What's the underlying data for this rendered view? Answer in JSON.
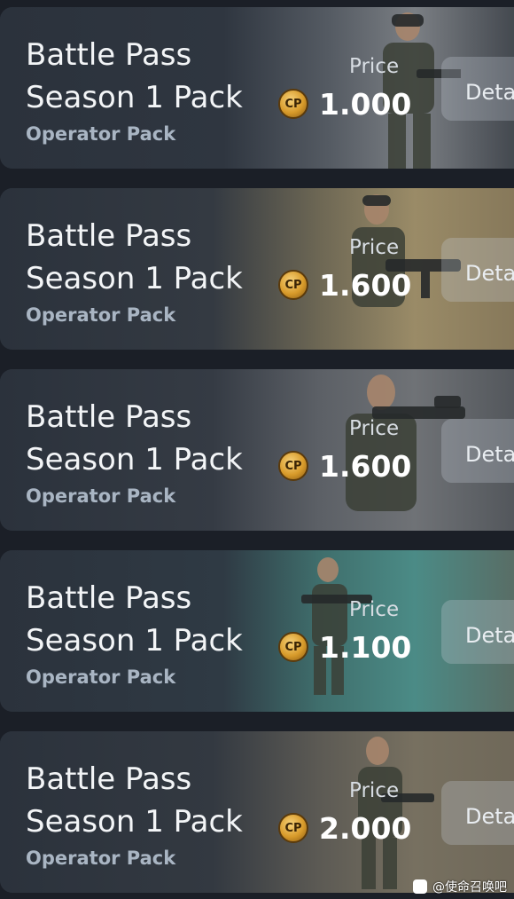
{
  "items": [
    {
      "title_line1": "Battle Pass",
      "title_line2": "Season 1 Pack",
      "subtitle": "Operator Pack",
      "price_label": "Price",
      "currency_icon": "CP",
      "price": "1.000",
      "details_label": "Deta"
    },
    {
      "title_line1": "Battle Pass",
      "title_line2": "Season 1 Pack",
      "subtitle": "Operator Pack",
      "price_label": "Price",
      "currency_icon": "CP",
      "price": "1.600",
      "details_label": "Deta"
    },
    {
      "title_line1": "Battle Pass",
      "title_line2": "Season 1 Pack",
      "subtitle": "Operator Pack",
      "price_label": "Price",
      "currency_icon": "CP",
      "price": "1.600",
      "details_label": "Deta"
    },
    {
      "title_line1": "Battle Pass",
      "title_line2": "Season 1 Pack",
      "subtitle": "Operator Pack",
      "price_label": "Price",
      "currency_icon": "CP",
      "price": "1.100",
      "details_label": "Deta"
    },
    {
      "title_line1": "Battle Pass",
      "title_line2": "Season 1 Pack",
      "subtitle": "Operator Pack",
      "price_label": "Price",
      "currency_icon": "CP",
      "price": "2.000",
      "details_label": "Deta"
    }
  ],
  "watermark": {
    "text": "@使命召唤吧",
    "icon": "weibo-icon"
  },
  "colors": {
    "background": "#1b1f27",
    "card": "#2a313b",
    "subtitle": "#a9b5c3",
    "coin": "#d79a2a"
  }
}
